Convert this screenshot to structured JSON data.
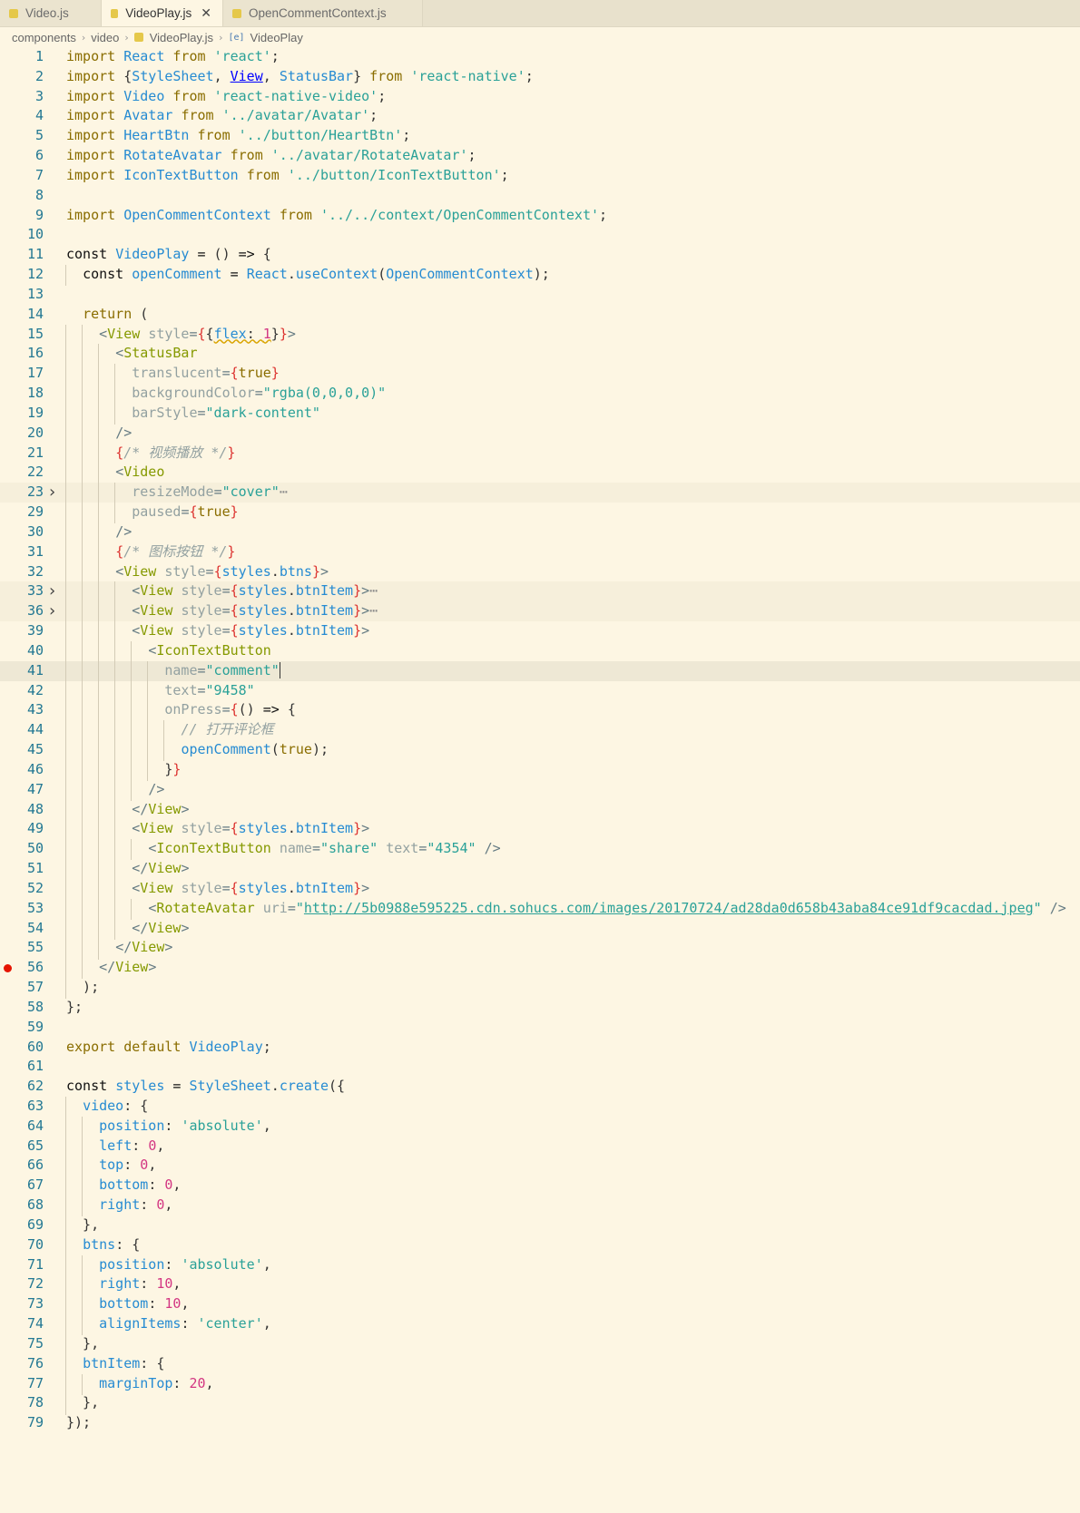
{
  "tabs": [
    {
      "label": "Video.js",
      "active": false
    },
    {
      "label": "VideoPlay.js",
      "active": true
    },
    {
      "label": "OpenCommentContext.js",
      "active": false
    }
  ],
  "breadcrumb": {
    "parts": [
      "components",
      "video",
      "VideoPlay.js",
      "VideoPlay"
    ]
  },
  "icons": {
    "js_file_icon": "js-file-icon",
    "symbol_icon": "symbol-variable-icon",
    "close_icon": "close-icon",
    "fold_icon": "chevron-right-icon"
  },
  "colors": {
    "background": "#fdf6e3",
    "line_number": "#237893",
    "breakpoint": "#e51400",
    "string": "#2aa198",
    "keyword": "#8a6d00",
    "tag": "#859900"
  },
  "editor": {
    "lines": [
      {
        "n": "1",
        "html": "<span class=\"kw\">import</span> <span class=\"id\">React</span> <span class=\"kw\">from</span> <span class=\"str\">'react'</span>;"
      },
      {
        "n": "2",
        "html": "<span class=\"kw\">import</span> {<span class=\"id\">StyleSheet</span>, <span class=\"ulink\">View</span>, <span class=\"id\">StatusBar</span>} <span class=\"kw\">from</span> <span class=\"str\">'react-native'</span>;"
      },
      {
        "n": "3",
        "html": "<span class=\"kw\">import</span> <span class=\"id\">Video</span> <span class=\"kw\">from</span> <span class=\"str\">'react-native-video'</span>;"
      },
      {
        "n": "4",
        "html": "<span class=\"kw\">import</span> <span class=\"id\">Avatar</span> <span class=\"kw\">from</span> <span class=\"str\">'../avatar/Avatar'</span>;"
      },
      {
        "n": "5",
        "html": "<span class=\"kw\">import</span> <span class=\"id\">HeartBtn</span> <span class=\"kw\">from</span> <span class=\"str\">'../button/HeartBtn'</span>;"
      },
      {
        "n": "6",
        "html": "<span class=\"kw\">import</span> <span class=\"id\">RotateAvatar</span> <span class=\"kw\">from</span> <span class=\"str\">'../avatar/RotateAvatar'</span>;"
      },
      {
        "n": "7",
        "html": "<span class=\"kw\">import</span> <span class=\"id\">IconTextButton</span> <span class=\"kw\">from</span> <span class=\"str\">'../button/IconTextButton'</span>;"
      },
      {
        "n": "8",
        "html": ""
      },
      {
        "n": "9",
        "html": "<span class=\"kw\">import</span> <span class=\"id\">OpenCommentContext</span> <span class=\"kw\">from</span> <span class=\"str\">'../../context/OpenCommentContext'</span>;"
      },
      {
        "n": "10",
        "html": ""
      },
      {
        "n": "11",
        "html": "<span class=\"kw2\">const</span> <span class=\"fn\">VideoPlay</span> <span class=\"kw2\">=</span> () <span class=\"kw2\">=&gt;</span> {"
      },
      {
        "n": "12",
        "html": "<span class=\"guide\"></span>  <span class=\"kw2\">const</span> <span class=\"id\">openComment</span> <span class=\"kw2\">=</span> <span class=\"id\">React</span>.<span class=\"fn\">useContext</span>(<span class=\"id\">OpenCommentContext</span>);"
      },
      {
        "n": "13",
        "html": ""
      },
      {
        "n": "14",
        "html": "  <span class=\"kw\">return</span> ("
      },
      {
        "n": "15",
        "html": "<span class=\"guide\"></span>  <span class=\"guide\"></span>  <span class=\"punc\">&lt;</span><span class=\"tag\">View</span> <span class=\"attr\">style</span><span class=\"punc\">=</span><span class=\"brace\">{</span>{<span class=\"squig\"><span class=\"prop\">flex</span>: <span class=\"num\">1</span></span>}<span class=\"brace\">}</span><span class=\"punc\">&gt;</span>"
      },
      {
        "n": "16",
        "html": "<span class=\"guide\"></span>  <span class=\"guide\"></span>  <span class=\"guide\"></span>  <span class=\"punc\">&lt;</span><span class=\"tag\">StatusBar</span>"
      },
      {
        "n": "17",
        "html": "<span class=\"guide\"></span>  <span class=\"guide\"></span>  <span class=\"guide\"></span>  <span class=\"guide\"></span>  <span class=\"attr\">translucent</span><span class=\"punc\">=</span><span class=\"brace\">{</span><span class=\"kw\">true</span><span class=\"brace\">}</span>"
      },
      {
        "n": "18",
        "html": "<span class=\"guide\"></span>  <span class=\"guide\"></span>  <span class=\"guide\"></span>  <span class=\"guide\"></span>  <span class=\"attr\">backgroundColor</span><span class=\"punc\">=</span><span class=\"str\">\"rgba(0,0,0,0)\"</span>"
      },
      {
        "n": "19",
        "html": "<span class=\"guide\"></span>  <span class=\"guide\"></span>  <span class=\"guide\"></span>  <span class=\"guide\"></span>  <span class=\"attr\">barStyle</span><span class=\"punc\">=</span><span class=\"str\">\"dark-content\"</span>"
      },
      {
        "n": "20",
        "html": "<span class=\"guide\"></span>  <span class=\"guide\"></span>  <span class=\"guide\"></span>  <span class=\"punc\">/&gt;</span>"
      },
      {
        "n": "21",
        "html": "<span class=\"guide\"></span>  <span class=\"guide\"></span>  <span class=\"guide\"></span>  <span class=\"brace\">{</span><span class=\"com\">/* 视频播放 */</span><span class=\"brace\">}</span>"
      },
      {
        "n": "22",
        "html": "<span class=\"guide\"></span>  <span class=\"guide\"></span>  <span class=\"guide\"></span>  <span class=\"punc\">&lt;</span><span class=\"tag\">Video</span>"
      },
      {
        "n": "23",
        "fold": true,
        "hl": "fold",
        "html": "<span class=\"guide\"></span>  <span class=\"guide\"></span>  <span class=\"guide\"></span>  <span class=\"guide\"></span>  <span class=\"attr\">resizeMode</span><span class=\"punc\">=</span><span class=\"str\">\"cover\"</span><span class=\"ellipsis\">⋯</span>"
      },
      {
        "n": "29",
        "html": "<span class=\"guide\"></span>  <span class=\"guide\"></span>  <span class=\"guide\"></span>  <span class=\"guide\"></span>  <span class=\"attr\">paused</span><span class=\"punc\">=</span><span class=\"brace\">{</span><span class=\"kw\">true</span><span class=\"brace\">}</span>"
      },
      {
        "n": "30",
        "html": "<span class=\"guide\"></span>  <span class=\"guide\"></span>  <span class=\"guide\"></span>  <span class=\"punc\">/&gt;</span>"
      },
      {
        "n": "31",
        "html": "<span class=\"guide\"></span>  <span class=\"guide\"></span>  <span class=\"guide\"></span>  <span class=\"brace\">{</span><span class=\"com\">/* 图标按钮 */</span><span class=\"brace\">}</span>"
      },
      {
        "n": "32",
        "html": "<span class=\"guide\"></span>  <span class=\"guide\"></span>  <span class=\"guide\"></span>  <span class=\"punc\">&lt;</span><span class=\"tag\">View</span> <span class=\"attr\">style</span><span class=\"punc\">=</span><span class=\"brace\">{</span><span class=\"prop\">styles</span>.<span class=\"prop\">btns</span><span class=\"brace\">}</span><span class=\"punc\">&gt;</span>"
      },
      {
        "n": "33",
        "fold": true,
        "hl": "fold",
        "html": "<span class=\"guide\"></span>  <span class=\"guide\"></span>  <span class=\"guide\"></span>  <span class=\"guide\"></span>  <span class=\"punc\">&lt;</span><span class=\"tag\">View</span> <span class=\"attr\">style</span><span class=\"punc\">=</span><span class=\"brace\">{</span><span class=\"prop\">styles</span>.<span class=\"prop\">btnItem</span><span class=\"brace\">}</span><span class=\"punc\">&gt;</span><span class=\"ellipsis\">⋯</span>"
      },
      {
        "n": "36",
        "fold": true,
        "hl": "fold",
        "html": "<span class=\"guide\"></span>  <span class=\"guide\"></span>  <span class=\"guide\"></span>  <span class=\"guide\"></span>  <span class=\"punc\">&lt;</span><span class=\"tag\">View</span> <span class=\"attr\">style</span><span class=\"punc\">=</span><span class=\"brace\">{</span><span class=\"prop\">styles</span>.<span class=\"prop\">btnItem</span><span class=\"brace\">}</span><span class=\"punc\">&gt;</span><span class=\"ellipsis\">⋯</span>"
      },
      {
        "n": "39",
        "html": "<span class=\"guide\"></span>  <span class=\"guide\"></span>  <span class=\"guide\"></span>  <span class=\"guide\"></span>  <span class=\"punc\">&lt;</span><span class=\"tag\">View</span> <span class=\"attr\">style</span><span class=\"punc\">=</span><span class=\"brace\">{</span><span class=\"prop\">styles</span>.<span class=\"prop\">btnItem</span><span class=\"brace\">}</span><span class=\"punc\">&gt;</span>"
      },
      {
        "n": "40",
        "html": "<span class=\"guide\"></span>  <span class=\"guide\"></span>  <span class=\"guide\"></span>  <span class=\"guide\"></span>  <span class=\"guide\"></span>  <span class=\"punc\">&lt;</span><span class=\"tag\">IconTextButton</span>"
      },
      {
        "n": "41",
        "hl": "cur",
        "html": "<span class=\"guide\"></span>  <span class=\"guide\"></span>  <span class=\"guide\"></span>  <span class=\"guide\"></span>  <span class=\"guide\"></span>  <span class=\"guide\"></span>  <span class=\"attr\">name</span><span class=\"punc\">=</span><span class=\"str\">\"comment\"</span><span class=\"cursor\"></span>"
      },
      {
        "n": "42",
        "html": "<span class=\"guide\"></span>  <span class=\"guide\"></span>  <span class=\"guide\"></span>  <span class=\"guide\"></span>  <span class=\"guide\"></span>  <span class=\"guide\"></span>  <span class=\"attr\">text</span><span class=\"punc\">=</span><span class=\"str\">\"9458\"</span>"
      },
      {
        "n": "43",
        "html": "<span class=\"guide\"></span>  <span class=\"guide\"></span>  <span class=\"guide\"></span>  <span class=\"guide\"></span>  <span class=\"guide\"></span>  <span class=\"guide\"></span>  <span class=\"attr\">onPress</span><span class=\"punc\">=</span><span class=\"brace\">{</span>() <span class=\"kw2\">=&gt;</span> {"
      },
      {
        "n": "44",
        "html": "<span class=\"guide\"></span>  <span class=\"guide\"></span>  <span class=\"guide\"></span>  <span class=\"guide\"></span>  <span class=\"guide\"></span>  <span class=\"guide\"></span>  <span class=\"guide\"></span>  <span class=\"com\">// 打开评论框</span>"
      },
      {
        "n": "45",
        "html": "<span class=\"guide\"></span>  <span class=\"guide\"></span>  <span class=\"guide\"></span>  <span class=\"guide\"></span>  <span class=\"guide\"></span>  <span class=\"guide\"></span>  <span class=\"guide\"></span>  <span class=\"fn\">openComment</span>(<span class=\"kw\">true</span>);"
      },
      {
        "n": "46",
        "html": "<span class=\"guide\"></span>  <span class=\"guide\"></span>  <span class=\"guide\"></span>  <span class=\"guide\"></span>  <span class=\"guide\"></span>  <span class=\"guide\"></span>  }<span class=\"brace\">}</span>"
      },
      {
        "n": "47",
        "html": "<span class=\"guide\"></span>  <span class=\"guide\"></span>  <span class=\"guide\"></span>  <span class=\"guide\"></span>  <span class=\"guide\"></span>  <span class=\"punc\">/&gt;</span>"
      },
      {
        "n": "48",
        "html": "<span class=\"guide\"></span>  <span class=\"guide\"></span>  <span class=\"guide\"></span>  <span class=\"guide\"></span>  <span class=\"punc\">&lt;/</span><span class=\"tag\">View</span><span class=\"punc\">&gt;</span>"
      },
      {
        "n": "49",
        "html": "<span class=\"guide\"></span>  <span class=\"guide\"></span>  <span class=\"guide\"></span>  <span class=\"guide\"></span>  <span class=\"punc\">&lt;</span><span class=\"tag\">View</span> <span class=\"attr\">style</span><span class=\"punc\">=</span><span class=\"brace\">{</span><span class=\"prop\">styles</span>.<span class=\"prop\">btnItem</span><span class=\"brace\">}</span><span class=\"punc\">&gt;</span>"
      },
      {
        "n": "50",
        "html": "<span class=\"guide\"></span>  <span class=\"guide\"></span>  <span class=\"guide\"></span>  <span class=\"guide\"></span>  <span class=\"guide\"></span>  <span class=\"punc\">&lt;</span><span class=\"tag\">IconTextButton</span> <span class=\"attr\">name</span><span class=\"punc\">=</span><span class=\"str\">\"share\"</span> <span class=\"attr\">text</span><span class=\"punc\">=</span><span class=\"str\">\"4354\"</span> <span class=\"punc\">/&gt;</span>"
      },
      {
        "n": "51",
        "html": "<span class=\"guide\"></span>  <span class=\"guide\"></span>  <span class=\"guide\"></span>  <span class=\"guide\"></span>  <span class=\"punc\">&lt;/</span><span class=\"tag\">View</span><span class=\"punc\">&gt;</span>"
      },
      {
        "n": "52",
        "html": "<span class=\"guide\"></span>  <span class=\"guide\"></span>  <span class=\"guide\"></span>  <span class=\"guide\"></span>  <span class=\"punc\">&lt;</span><span class=\"tag\">View</span> <span class=\"attr\">style</span><span class=\"punc\">=</span><span class=\"brace\">{</span><span class=\"prop\">styles</span>.<span class=\"prop\">btnItem</span><span class=\"brace\">}</span><span class=\"punc\">&gt;</span>"
      },
      {
        "n": "53",
        "html": "<span class=\"guide\"></span>  <span class=\"guide\"></span>  <span class=\"guide\"></span>  <span class=\"guide\"></span>  <span class=\"guide\"></span>  <span class=\"punc\">&lt;</span><span class=\"tag\">RotateAvatar</span> <span class=\"attr\">uri</span><span class=\"punc\">=</span><span class=\"str\">\"</span><span class=\"link\">http://5b0988e595225.cdn.sohucs.com/images/20170724/ad28da0d658b43aba84ce91df9cacdad.jpeg</span><span class=\"str\">\"</span> <span class=\"punc\">/&gt;</span>"
      },
      {
        "n": "54",
        "html": "<span class=\"guide\"></span>  <span class=\"guide\"></span>  <span class=\"guide\"></span>  <span class=\"guide\"></span>  <span class=\"punc\">&lt;/</span><span class=\"tag\">View</span><span class=\"punc\">&gt;</span>"
      },
      {
        "n": "55",
        "html": "<span class=\"guide\"></span>  <span class=\"guide\"></span>  <span class=\"guide\"></span>  <span class=\"punc\">&lt;/</span><span class=\"tag\">View</span><span class=\"punc\">&gt;</span>"
      },
      {
        "n": "56",
        "bp": true,
        "html": "<span class=\"guide\"></span>  <span class=\"guide\"></span>  <span class=\"punc\">&lt;/</span><span class=\"tag\">View</span><span class=\"punc\">&gt;</span>"
      },
      {
        "n": "57",
        "html": "<span class=\"guide\"></span>  );"
      },
      {
        "n": "58",
        "html": "};"
      },
      {
        "n": "59",
        "html": ""
      },
      {
        "n": "60",
        "html": "<span class=\"kw\">export</span> <span class=\"kw\">default</span> <span class=\"id\">VideoPlay</span>;"
      },
      {
        "n": "61",
        "html": ""
      },
      {
        "n": "62",
        "html": "<span class=\"kw2\">const</span> <span class=\"id\">styles</span> <span class=\"kw2\">=</span> <span class=\"id\">StyleSheet</span>.<span class=\"fn\">create</span>({"
      },
      {
        "n": "63",
        "html": "<span class=\"guide\"></span>  <span class=\"prop\">video</span>: {"
      },
      {
        "n": "64",
        "html": "<span class=\"guide\"></span>  <span class=\"guide\"></span>  <span class=\"prop\">position</span>: <span class=\"str\">'absolute'</span>,"
      },
      {
        "n": "65",
        "html": "<span class=\"guide\"></span>  <span class=\"guide\"></span>  <span class=\"prop\">left</span>: <span class=\"num\">0</span>,"
      },
      {
        "n": "66",
        "html": "<span class=\"guide\"></span>  <span class=\"guide\"></span>  <span class=\"prop\">top</span>: <span class=\"num\">0</span>,"
      },
      {
        "n": "67",
        "html": "<span class=\"guide\"></span>  <span class=\"guide\"></span>  <span class=\"prop\">bottom</span>: <span class=\"num\">0</span>,"
      },
      {
        "n": "68",
        "html": "<span class=\"guide\"></span>  <span class=\"guide\"></span>  <span class=\"prop\">right</span>: <span class=\"num\">0</span>,"
      },
      {
        "n": "69",
        "html": "<span class=\"guide\"></span>  },"
      },
      {
        "n": "70",
        "html": "<span class=\"guide\"></span>  <span class=\"prop\">btns</span>: {"
      },
      {
        "n": "71",
        "html": "<span class=\"guide\"></span>  <span class=\"guide\"></span>  <span class=\"prop\">position</span>: <span class=\"str\">'absolute'</span>,"
      },
      {
        "n": "72",
        "html": "<span class=\"guide\"></span>  <span class=\"guide\"></span>  <span class=\"prop\">right</span>: <span class=\"num\">10</span>,"
      },
      {
        "n": "73",
        "html": "<span class=\"guide\"></span>  <span class=\"guide\"></span>  <span class=\"prop\">bottom</span>: <span class=\"num\">10</span>,"
      },
      {
        "n": "74",
        "html": "<span class=\"guide\"></span>  <span class=\"guide\"></span>  <span class=\"prop\">alignItems</span>: <span class=\"str\">'center'</span>,"
      },
      {
        "n": "75",
        "html": "<span class=\"guide\"></span>  },"
      },
      {
        "n": "76",
        "html": "<span class=\"guide\"></span>  <span class=\"prop\">btnItem</span>: {"
      },
      {
        "n": "77",
        "html": "<span class=\"guide\"></span>  <span class=\"guide\"></span>  <span class=\"prop\">marginTop</span>: <span class=\"num\">20</span>,"
      },
      {
        "n": "78",
        "html": "<span class=\"guide\"></span>  },"
      },
      {
        "n": "79",
        "html": "});"
      }
    ]
  }
}
